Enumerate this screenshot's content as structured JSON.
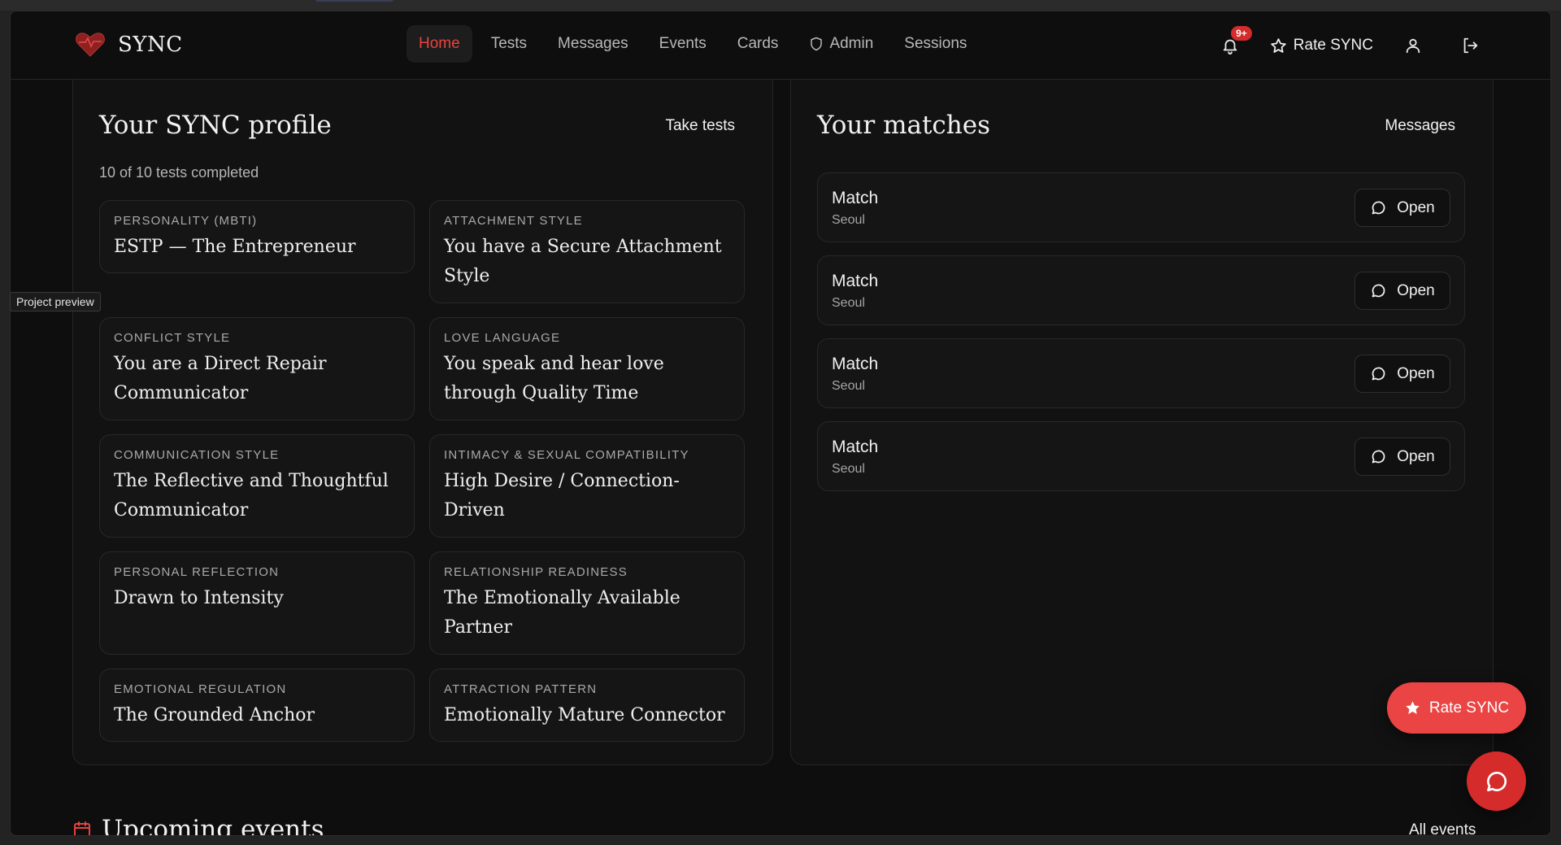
{
  "brand": {
    "name": "SYNC"
  },
  "nav": {
    "items": [
      {
        "label": "Home",
        "active": true
      },
      {
        "label": "Tests"
      },
      {
        "label": "Messages"
      },
      {
        "label": "Events"
      },
      {
        "label": "Cards"
      },
      {
        "label": "Admin",
        "icon": "shield-icon"
      },
      {
        "label": "Sessions"
      }
    ]
  },
  "header": {
    "notifications_badge": "9+",
    "rate_label": "Rate SYNC"
  },
  "tooltip": "Project preview",
  "profile": {
    "title": "Your SYNC profile",
    "action_label": "Take tests",
    "progress_text": "10 of 10 tests completed",
    "cards": [
      {
        "label": "PERSONALITY (MBTI)",
        "value": "ESTP — The Entrepreneur"
      },
      {
        "label": "ATTACHMENT STYLE",
        "value": "You have a Secure Attachment Style"
      },
      {
        "label": "CONFLICT STYLE",
        "value": "You are a Direct Repair Communicator"
      },
      {
        "label": "LOVE LANGUAGE",
        "value": "You speak and hear love through Quality Time"
      },
      {
        "label": "COMMUNICATION STYLE",
        "value": "The Reflective and Thoughtful Communicator"
      },
      {
        "label": "INTIMACY & SEXUAL COMPATIBILITY",
        "value": "High Desire / Connection-Driven"
      },
      {
        "label": "PERSONAL REFLECTION",
        "value": "Drawn to Intensity"
      },
      {
        "label": "RELATIONSHIP READINESS",
        "value": "The Emotionally Available Partner"
      },
      {
        "label": "EMOTIONAL REGULATION",
        "value": "The Grounded Anchor"
      },
      {
        "label": "ATTRACTION PATTERN",
        "value": "Emotionally Mature Connector"
      }
    ]
  },
  "matches": {
    "title": "Your matches",
    "action_label": "Messages",
    "open_label": "Open",
    "items": [
      {
        "name": "Match",
        "city": "Seoul"
      },
      {
        "name": "Match",
        "city": "Seoul"
      },
      {
        "name": "Match",
        "city": "Seoul"
      },
      {
        "name": "Match",
        "city": "Seoul"
      }
    ]
  },
  "events": {
    "title": "Upcoming events",
    "action_label": "All events"
  },
  "fab": {
    "rate_label": "Rate SYNC"
  },
  "colors": {
    "accent": "#e8433e",
    "fab": "#ea4444",
    "background": "#0e0e0e"
  }
}
